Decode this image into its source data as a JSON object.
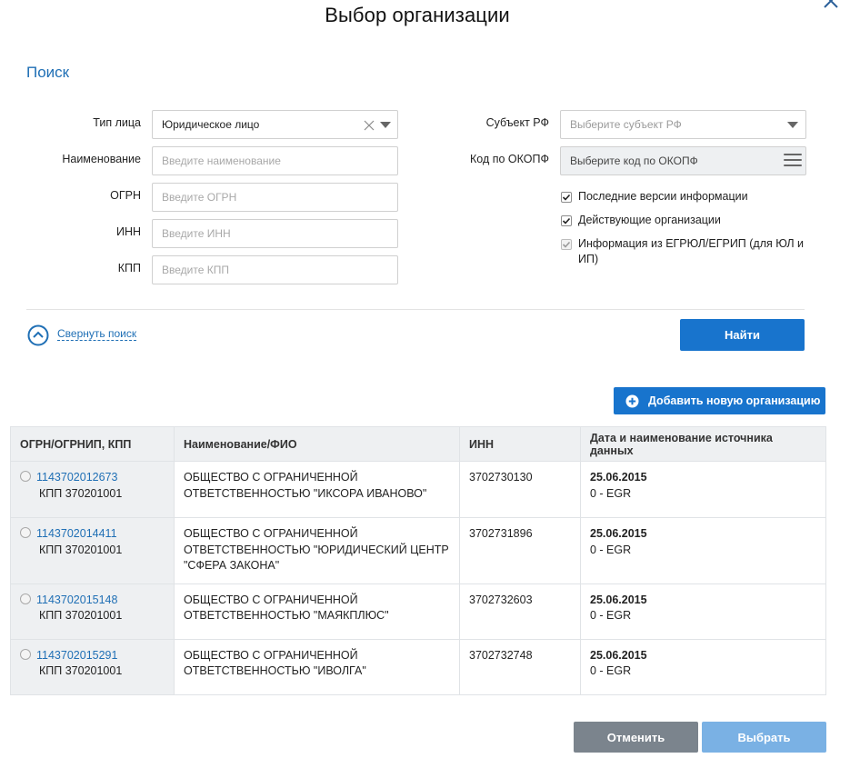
{
  "dialog": {
    "title": "Выбор организации"
  },
  "search": {
    "section_title": "Поиск",
    "person_type": {
      "label": "Тип лица",
      "value": "Юридическое лицо"
    },
    "name": {
      "label": "Наименование",
      "placeholder": "Введите наименование"
    },
    "ogrn": {
      "label": "ОГРН",
      "placeholder": "Введите ОГРН"
    },
    "inn": {
      "label": "ИНН",
      "placeholder": "Введите ИНН"
    },
    "kpp": {
      "label": "КПП",
      "placeholder": "Введите КПП"
    },
    "subject": {
      "label": "Субъект РФ",
      "placeholder": "Выберите субъект РФ"
    },
    "okopf": {
      "label": "Код по ОКОПФ",
      "placeholder": "Выберите код по ОКОПФ"
    },
    "checkboxes": [
      {
        "label": "Последние версии информации",
        "checked": true,
        "disabled": false
      },
      {
        "label": "Действующие организации",
        "checked": true,
        "disabled": false
      },
      {
        "label": "Информация из ЕГРЮЛ/ЕГРИП (для ЮЛ и ИП)",
        "checked": true,
        "disabled": true
      }
    ],
    "collapse_label": "Свернуть поиск",
    "find_button": "Найти"
  },
  "add_org_button": "Добавить новую организацию",
  "table": {
    "headers": [
      "ОГРН/ОГРНИП, КПП",
      "Наименование/ФИО",
      "ИНН",
      "Дата и наименование источника данных"
    ],
    "rows": [
      {
        "ogrn": "1143702012673",
        "kpp": "КПП 370201001",
        "name": "ОБЩЕСТВО С ОГРАНИЧЕННОЙ ОТВЕТСТВЕННОСТЬЮ \"ИКСОРА ИВАНОВО\"",
        "inn": "3702730130",
        "date": "25.06.2015",
        "source": "0 - EGR"
      },
      {
        "ogrn": "1143702014411",
        "kpp": "КПП 370201001",
        "name": "ОБЩЕСТВО С ОГРАНИЧЕННОЙ ОТВЕТСТВЕННОСТЬЮ \"ЮРИДИЧЕСКИЙ ЦЕНТР \"СФЕРА ЗАКОНА\"",
        "inn": "3702731896",
        "date": "25.06.2015",
        "source": "0 - EGR"
      },
      {
        "ogrn": "1143702015148",
        "kpp": "КПП 370201001",
        "name": "ОБЩЕСТВО С ОГРАНИЧЕННОЙ ОТВЕТСТВЕННОСТЬЮ \"МАЯКПЛЮС\"",
        "inn": "3702732603",
        "date": "25.06.2015",
        "source": "0 - EGR"
      },
      {
        "ogrn": "1143702015291",
        "kpp": "КПП 370201001",
        "name": "ОБЩЕСТВО С ОГРАНИЧЕННОЙ ОТВЕТСТВЕННОСТЬЮ \"ИВОЛГА\"",
        "inn": "3702732748",
        "date": "25.06.2015",
        "source": "0 - EGR"
      }
    ]
  },
  "footer": {
    "cancel_button": "Отменить",
    "select_button": "Выбрать"
  },
  "colors": {
    "accent": "#1874cd",
    "link": "#1f6fb5",
    "cancel_bg": "#7b848d",
    "select_disabled_bg": "#7ab1e4"
  }
}
